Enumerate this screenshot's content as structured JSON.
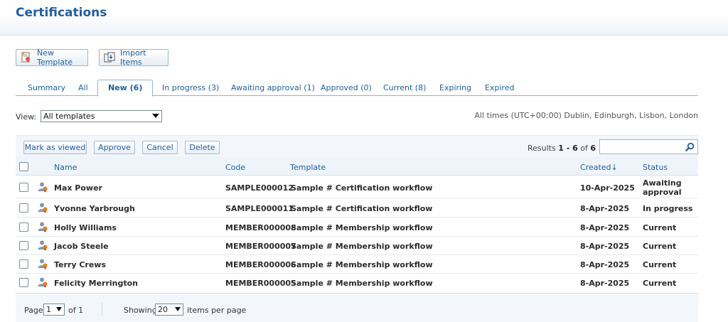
{
  "page": {
    "title": "Certifications"
  },
  "toolbar": {
    "new_template": "New Template",
    "import_items": "Import Items"
  },
  "tabs": [
    {
      "label": "Summary"
    },
    {
      "label": "All"
    },
    {
      "label": "New (6)",
      "active": true
    },
    {
      "label": "In progress (3)"
    },
    {
      "label": "Awaiting approval (1)"
    },
    {
      "label": "Approved (0)"
    },
    {
      "label": "Current (8)"
    },
    {
      "label": "Expiring"
    },
    {
      "label": "Expired"
    }
  ],
  "filter": {
    "view_label": "View:",
    "view_value": "All templates",
    "timezone": "All times (UTC+00:00) Dublin, Edinburgh, Lisbon, London"
  },
  "actions": {
    "mark_viewed": "Mark as viewed",
    "approve": "Approve",
    "cancel": "Cancel",
    "delete": "Delete",
    "results_prefix": "Results",
    "results_range": "1 - 6",
    "results_of": "of",
    "results_total": "6",
    "search_value": ""
  },
  "table": {
    "columns": {
      "name": "Name",
      "code": "Code",
      "template": "Template",
      "created": "Created",
      "created_sort": "↓",
      "status": "Status"
    },
    "rows": [
      {
        "name": "Max Power",
        "code": "SAMPLE000012",
        "template": "Sample # Certification workflow",
        "created": "10-Apr-2025",
        "status_line1": "Awaiting",
        "status_line2": "approval"
      },
      {
        "name": "Yvonne Yarbrough",
        "code": "SAMPLE000011",
        "template": "Sample # Certification workflow",
        "created": "8-Apr-2025",
        "status_line1": "In progress",
        "status_line2": ""
      },
      {
        "name": "Holly Williams",
        "code": "MEMBER000008",
        "template": "Sample # Membership workflow",
        "created": "8-Apr-2025",
        "status_line1": "Current",
        "status_line2": ""
      },
      {
        "name": "Jacob Steele",
        "code": "MEMBER000007",
        "template": "Sample # Membership workflow",
        "created": "8-Apr-2025",
        "status_line1": "Current",
        "status_line2": ""
      },
      {
        "name": "Terry Crews",
        "code": "MEMBER000006",
        "template": "Sample # Membership workflow",
        "created": "8-Apr-2025",
        "status_line1": "Current",
        "status_line2": ""
      },
      {
        "name": "Felicity Merrington",
        "code": "MEMBER000005",
        "template": "Sample # Membership workflow",
        "created": "8-Apr-2025",
        "status_line1": "Current",
        "status_line2": ""
      }
    ]
  },
  "pager": {
    "page_label": "Page",
    "page_value": "1",
    "of_label": "of 1",
    "showing_label": "Showing",
    "per_page_value": "20",
    "per_page_suffix": "items per page"
  },
  "colors": {
    "accent": "#1f5f9e",
    "tab_border": "#8fb3d6",
    "row_bg": "#f3f7fb"
  },
  "icons": {
    "new_template": "certificate-icon",
    "import_items": "import-icon",
    "search": "search-icon",
    "row": "user-badge-icon"
  }
}
